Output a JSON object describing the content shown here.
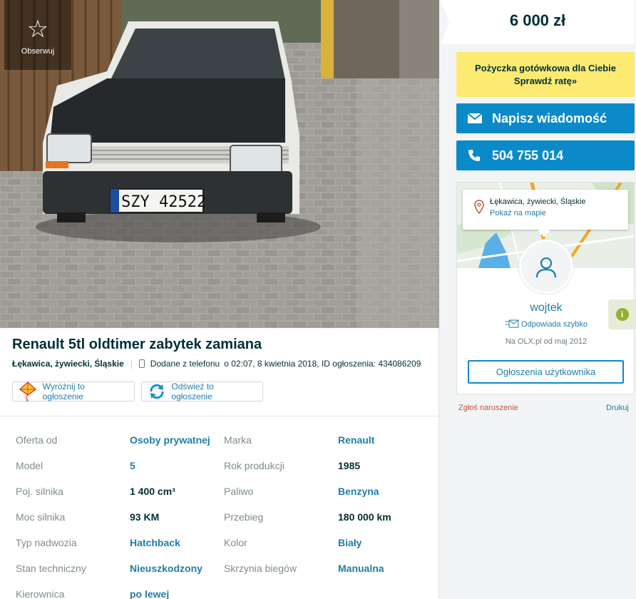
{
  "observe": {
    "label": "Obserwuj",
    "icon": "star-outline-icon"
  },
  "photo": {
    "plate": "SZY 42522",
    "plate_country": "PL"
  },
  "ad": {
    "title": "Renault 5tl oldtimer zabytek zamiana",
    "location": "Łękawica, żywiecki, Śląskie",
    "added_via": "Dodane z telefonu",
    "posted": "o 02:07, 8 kwietnia 2018, ID ogłoszenia: 434086209"
  },
  "promo": {
    "highlight_label": "Wyróżnij to ogłoszenie",
    "refresh_label": "Odśwież to ogłoszenie"
  },
  "details": [
    {
      "k1": "Oferta od",
      "v1": "Osoby prywatnej",
      "v1_link": true,
      "k2": "Marka",
      "v2": "Renault",
      "v2_link": true
    },
    {
      "k1": "Model",
      "v1": "5",
      "v1_link": true,
      "k2": "Rok produkcji",
      "v2": "1985",
      "v2_link": false
    },
    {
      "k1": "Poj. silnika",
      "v1": "1 400 cm³",
      "v1_link": false,
      "k2": "Paliwo",
      "v2": "Benzyna",
      "v2_link": true
    },
    {
      "k1": "Moc silnika",
      "v1": "93 KM",
      "v1_link": false,
      "k2": "Przebieg",
      "v2": "180 000 km",
      "v2_link": false
    },
    {
      "k1": "Typ nadwozia",
      "v1": "Hatchback",
      "v1_link": true,
      "k2": "Kolor",
      "v2": "Biały",
      "v2_link": true
    },
    {
      "k1": "Stan techniczny",
      "v1": "Nieuszkodzony",
      "v1_link": true,
      "k2": "Skrzynia biegów",
      "v2": "Manualna",
      "v2_link": true
    },
    {
      "k1": "Kierownica",
      "v1": "po lewej",
      "v1_link": true,
      "k2": "",
      "v2": "",
      "v2_link": false
    }
  ],
  "price": "6 000 zł",
  "loan": {
    "line1": "Pożyczka gotówkowa dla Ciebie",
    "line2": "Sprawdź ratę»"
  },
  "message_button": "Napisz wiadomość",
  "phone_button": "504 755 014",
  "seller": {
    "map_location": "Łękawica, żywiecki, Śląskie",
    "show_map": "Pokaż na mapie",
    "name": "wojtek",
    "responds": "Odpowiada szybko",
    "since": "Na OLX.pl od maj 2012",
    "user_ads": "Ogłoszenia użytkownika"
  },
  "info_tab": "i",
  "report": "Zgłoś naruszenie",
  "print": "Drukuj",
  "colors": {
    "accent": "#0a8ac9",
    "link": "#1f7ea8",
    "loan_bg": "#fdea72",
    "text": "#002f34",
    "report": "#c3553f"
  }
}
